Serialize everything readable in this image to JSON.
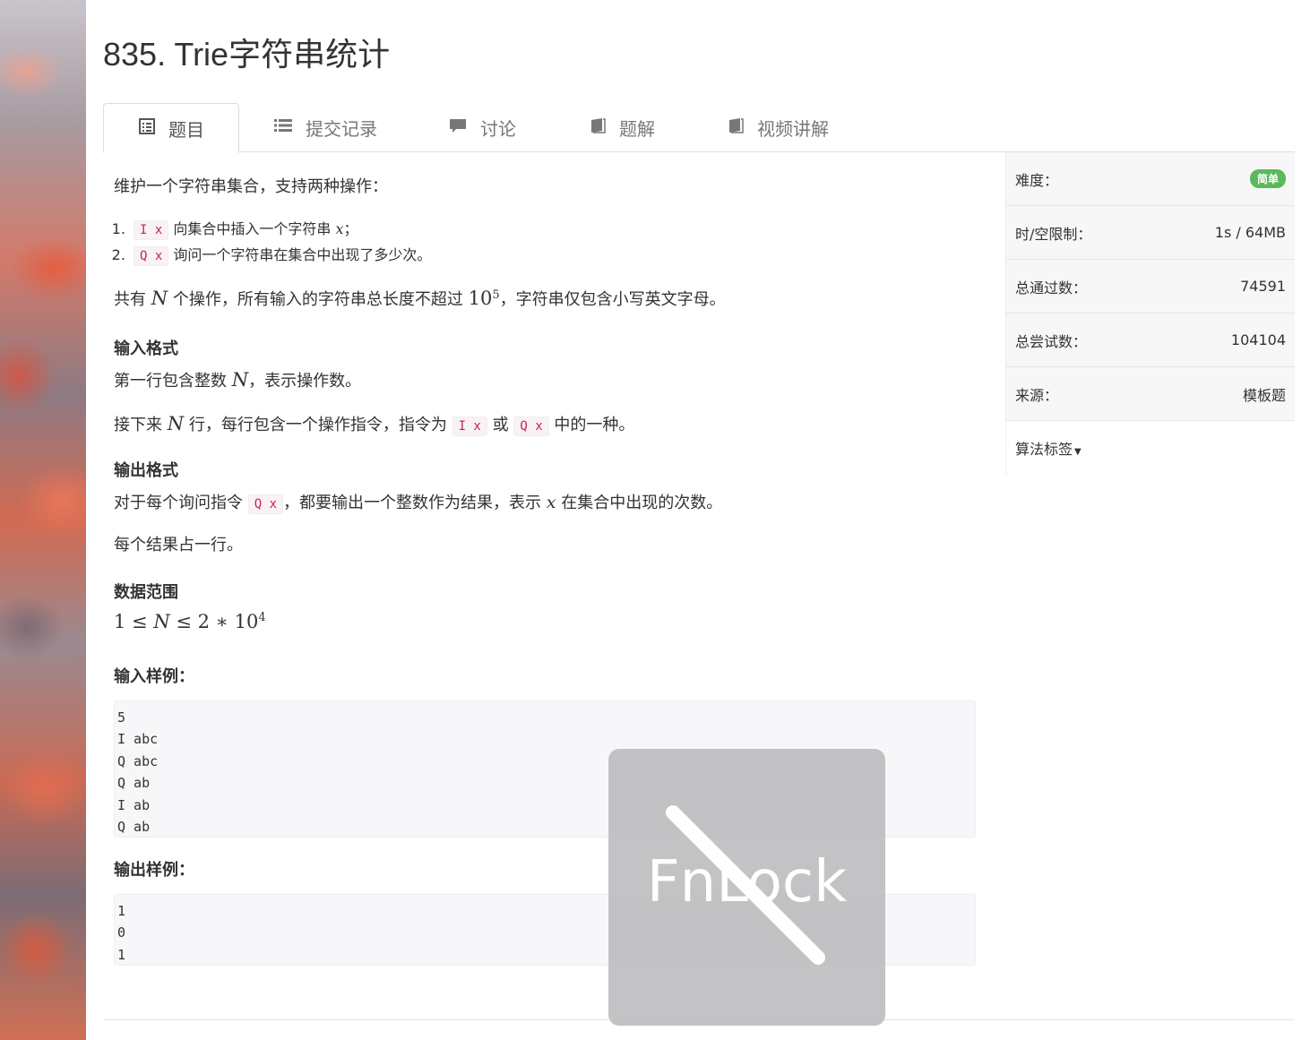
{
  "page_title": "835. Trie字符串统计",
  "tabs": [
    {
      "label": "题目",
      "icon": "list-alt-icon",
      "active": true
    },
    {
      "label": "提交记录",
      "icon": "list-icon"
    },
    {
      "label": "讨论",
      "icon": "comment-icon"
    },
    {
      "label": "题解",
      "icon": "book-icon"
    },
    {
      "label": "视频讲解",
      "icon": "book-icon"
    }
  ],
  "problem": {
    "intro": "维护一个字符串集合，支持两种操作：",
    "ops": [
      {
        "code": "I x",
        "text_before": "向集合中插入一个字符串",
        "var": "x",
        "text_after": "；"
      },
      {
        "code": "Q x",
        "text": "询问一个字符串在集合中出现了多少次。"
      }
    ],
    "constraint_pre": "共有",
    "constraint_var": "N",
    "constraint_mid": "个操作，所有输入的字符串总长度不超过",
    "constraint_base": "10",
    "constraint_exp": "5",
    "constraint_post": "，字符串仅包含小写英文字母。",
    "input_title": "输入格式",
    "input_line1_pre": "第一行包含整数",
    "input_line1_var": "N",
    "input_line1_post": "，表示操作数。",
    "input_line2_pre": "接下来",
    "input_line2_var": "N",
    "input_line2_mid": "行，每行包含一个操作指令，指令为",
    "input_line2_code1": "I x",
    "input_line2_or": "或",
    "input_line2_code2": "Q x",
    "input_line2_post": "中的一种。",
    "output_title": "输出格式",
    "output_line1_pre": "对于每个询问指令",
    "output_line1_code": "Q x",
    "output_line1_mid": "，都要输出一个整数作为结果，表示",
    "output_line1_var": "x",
    "output_line1_post": "在集合中出现的次数。",
    "output_line2": "每个结果占一行。",
    "range_title": "数据范围",
    "range_formula_a": "1 ≤ ",
    "range_formula_var": "N",
    "range_formula_b": " ≤ 2 ∗ 10",
    "range_formula_exp": "4",
    "sample_in_title": "输入样例：",
    "sample_in": "5\nI abc\nQ abc\nQ ab\nI ab\nQ ab",
    "sample_out_title": "输出样例：",
    "sample_out": "1\n0\n1"
  },
  "sidebar": {
    "difficulty_label": "难度：",
    "difficulty_value": "简单",
    "limit_label": "时/空限制：",
    "limit_value": "1s / 64MB",
    "passed_label": "总通过数：",
    "passed_value": "74591",
    "tried_label": "总尝试数：",
    "tried_value": "104104",
    "source_label": "来源：",
    "source_value": "模板题",
    "tags_label": "算法标签"
  },
  "overlay": {
    "text": "FnLock",
    "icon": "fnlock-disabled-icon"
  },
  "colors": {
    "badge_green": "#5cb85c",
    "code_red": "#c7254e"
  }
}
